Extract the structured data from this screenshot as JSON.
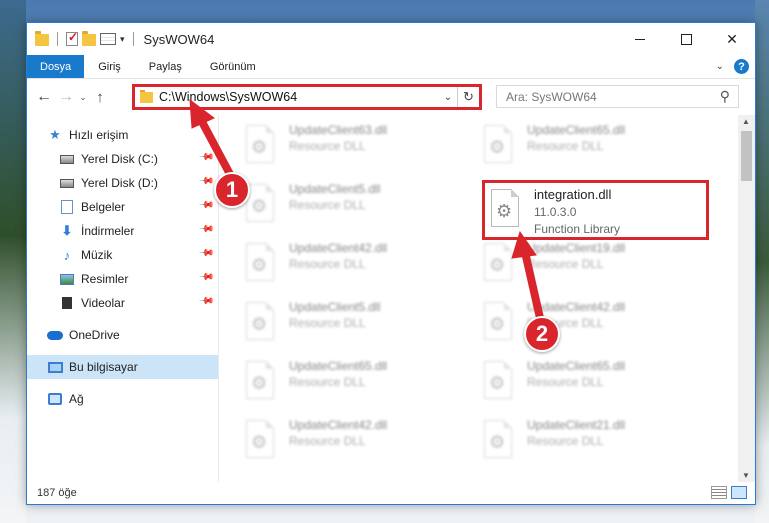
{
  "window": {
    "title": "SysWOW64"
  },
  "ribbon": {
    "tabs": [
      "Dosya",
      "Giriş",
      "Paylaş",
      "Görünüm"
    ],
    "help": "?"
  },
  "address": {
    "path": "C:\\Windows\\SysWOW64",
    "search_placeholder": "Ara: SysWOW64"
  },
  "sidebar": {
    "items": [
      {
        "label": "Hızlı erişim",
        "icon": "star-icon"
      },
      {
        "label": "Yerel Disk (C:)",
        "icon": "drive-icon",
        "pinned": true
      },
      {
        "label": "Yerel Disk (D:)",
        "icon": "drive-icon",
        "pinned": true
      },
      {
        "label": "Belgeler",
        "icon": "documents-icon",
        "pinned": true
      },
      {
        "label": "İndirmeler",
        "icon": "download-icon",
        "pinned": true
      },
      {
        "label": "Müzik",
        "icon": "music-icon",
        "pinned": true
      },
      {
        "label": "Resimler",
        "icon": "pictures-icon",
        "pinned": true
      },
      {
        "label": "Videolar",
        "icon": "videos-icon",
        "pinned": true
      },
      {
        "label": "OneDrive",
        "icon": "cloud-icon"
      },
      {
        "label": "Bu bilgisayar",
        "icon": "computer-icon",
        "selected": true
      },
      {
        "label": "Ağ",
        "icon": "network-icon"
      }
    ]
  },
  "files": {
    "left": [
      {
        "name": "UpdateClient63.dll",
        "desc": "Resource DLL"
      },
      {
        "name": "UpdateClient5.dll",
        "desc": "Resource DLL"
      },
      {
        "name": "UpdateClient42.dll",
        "desc": "Resource DLL"
      },
      {
        "name": "UpdateClient5.dll",
        "desc": "Resource DLL"
      },
      {
        "name": "UpdateClient65.dll",
        "desc": "Resource DLL"
      },
      {
        "name": "UpdateClient42.dll",
        "desc": "Resource DLL"
      }
    ],
    "right": [
      {
        "name": "UpdateClient65.dll",
        "desc": "Resource DLL"
      },
      {
        "name": "UpdateClient19.dll",
        "desc": "Resource DLL"
      },
      {
        "name": "UpdateClient42.dll",
        "desc": "Resource DLL"
      },
      {
        "name": "UpdateClient65.dll",
        "desc": "Resource DLL"
      },
      {
        "name": "UpdateClient21.dll",
        "desc": "Resource DLL"
      }
    ],
    "highlighted": {
      "name": "integration.dll",
      "version": "11.0.3.0",
      "desc": "Function Library"
    }
  },
  "status": {
    "count": "187 öğe"
  },
  "annotations": {
    "badge1": "1",
    "badge2": "2",
    "color": "#d9262d"
  }
}
